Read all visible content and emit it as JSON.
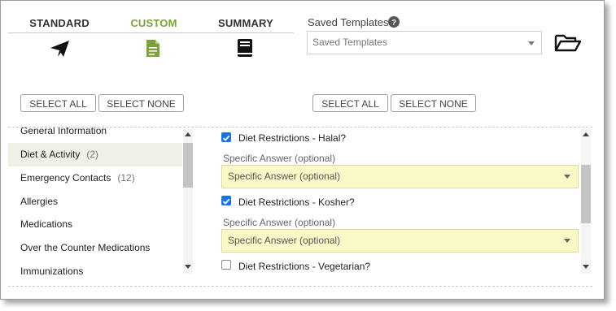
{
  "tabs": [
    {
      "label": "STANDARD",
      "icon": "paper-plane-icon",
      "active": false
    },
    {
      "label": "CUSTOM",
      "icon": "document-icon",
      "active": true
    },
    {
      "label": "SUMMARY",
      "icon": "book-icon",
      "active": false
    }
  ],
  "templates": {
    "label": "Saved Templates",
    "value": "Saved Templates",
    "help_icon": "help-circle-icon",
    "open_icon": "open-folder-icon"
  },
  "left_buttons": {
    "select_all": "SELECT ALL",
    "select_none": "SELECT NONE"
  },
  "right_buttons": {
    "select_all": "SELECT ALL",
    "select_none": "SELECT NONE"
  },
  "categories": [
    {
      "label": "General Information",
      "count": ""
    },
    {
      "label": "Diet & Activity",
      "count": "(2)",
      "selected": true
    },
    {
      "label": "Emergency Contacts",
      "count": "(12)"
    },
    {
      "label": "Allergies",
      "count": ""
    },
    {
      "label": "Medications",
      "count": ""
    },
    {
      "label": "Over the Counter Medications",
      "count": ""
    },
    {
      "label": "Immunizations",
      "count": ""
    }
  ],
  "fields": [
    {
      "label": "Diet Restrictions - Halal?",
      "checked": true,
      "answer_label": "Specific Answer (optional)",
      "answer_value": "Specific Answer (optional)"
    },
    {
      "label": "Diet Restrictions - Kosher?",
      "checked": true,
      "answer_label": "Specific Answer (optional)",
      "answer_value": "Specific Answer (optional)"
    },
    {
      "label": "Diet Restrictions - Vegetarian?",
      "checked": false
    }
  ],
  "colors": {
    "active_tab": "#7ea23b",
    "checkbox": "#1a73e8",
    "answer_bg": "#fbf8c7",
    "selected_row": "#eef2e6"
  }
}
